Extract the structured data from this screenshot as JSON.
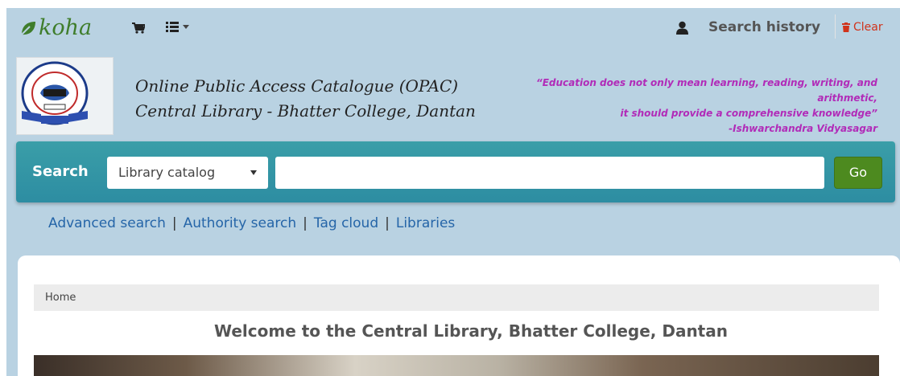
{
  "navbar": {
    "logo_text": "koha",
    "search_history_label": "Search history",
    "clear_label": "Clear",
    "icons": [
      "cart-icon",
      "list-icon",
      "user-icon",
      "trash-icon"
    ]
  },
  "header": {
    "opac_line1": "Online Public Access Catalogue (OPAC)",
    "opac_line2": "Central Library - Bhatter College, Dantan",
    "quote_line1": "“Education does not only mean learning, reading, writing, and",
    "quote_line2": "arithmetic,",
    "quote_line3": "it should provide a comprehensive knowledge”",
    "quote_author": "-Ishwarchandra Vidyasagar",
    "crest_text_top": "BHATTER COLLEGE DANTAN",
    "crest_text_estd": "ESTD - 1963"
  },
  "search": {
    "label": "Search",
    "selected_option": "Library catalog",
    "input_value": "",
    "go_label": "Go"
  },
  "links": [
    "Advanced search",
    "Authority search",
    "Tag cloud",
    "Libraries"
  ],
  "content": {
    "breadcrumb": "Home",
    "welcome": "Welcome to the Central Library, Bhatter College, Dantan"
  },
  "colors": {
    "page_bg": "#b9d2e2",
    "searchbar": "#3a9ea8",
    "go_button": "#4d8a1f",
    "link": "#2565a8",
    "quote": "#b12bb8",
    "clear": "#d0331b",
    "logo": "#3f7d2b"
  }
}
